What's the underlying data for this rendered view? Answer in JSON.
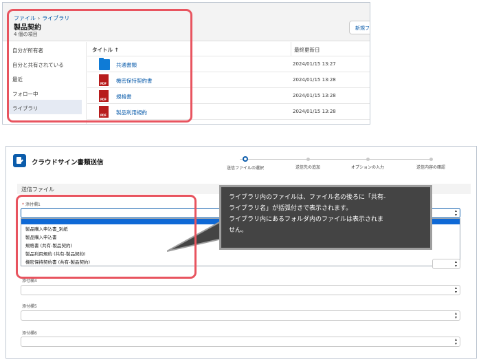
{
  "library": {
    "breadcrumb": [
      "ファイル",
      "ライブラリ"
    ],
    "title": "製品契約",
    "item_count": "4 個の項目",
    "new_button": "新規フ",
    "sidebar": [
      "自分が所有者",
      "自分と共有されている",
      "最近",
      "フォロー中",
      "ライブラリ"
    ],
    "columns": {
      "title": "タイトル ↑",
      "modified": "最終更新日"
    },
    "files": [
      {
        "name": "共通書類",
        "type": "folder",
        "date": "2024/01/15 13:27"
      },
      {
        "name": "機密保持契約書",
        "type": "pdf",
        "date": "2024/01/15 13:28"
      },
      {
        "name": "規格書",
        "type": "pdf",
        "date": "2024/01/15 13:28"
      },
      {
        "name": "製品利用規約",
        "type": "pdf",
        "date": "2024/01/15 13:28"
      }
    ]
  },
  "cloudsign": {
    "title": "クラウドサイン書類送信",
    "steps": [
      "送信ファイルの選択",
      "送信先の追加",
      "オプションの入力",
      "送信内容の確認"
    ],
    "section": "送信ファイル",
    "fields": {
      "attachment1_label": "添付欄1",
      "attachment4_label": "添付欄4",
      "attachment5_label": "添付欄5",
      "attachment6_label": "添付欄6"
    },
    "dropdown_options": [
      "製品購入申込書_別紙",
      "製品購入申込書",
      "規格書 (共有-製品契約)",
      "製品利用規約 (共有-製品契約)",
      "機密保持契約書 (共有-製品契約)"
    ],
    "callout_lines": [
      "ライブラリ内のファイルは、ファイル名の後ろに「共有-",
      "ライブラリ名」が括弧付きで表示されます。",
      "ライブラリ内にあるフォルダ内のファイルは表示されま",
      "せん。"
    ]
  },
  "colors": {
    "highlight": "#e8545f",
    "accent": "#0b5cab",
    "callout_bg": "#444444"
  }
}
